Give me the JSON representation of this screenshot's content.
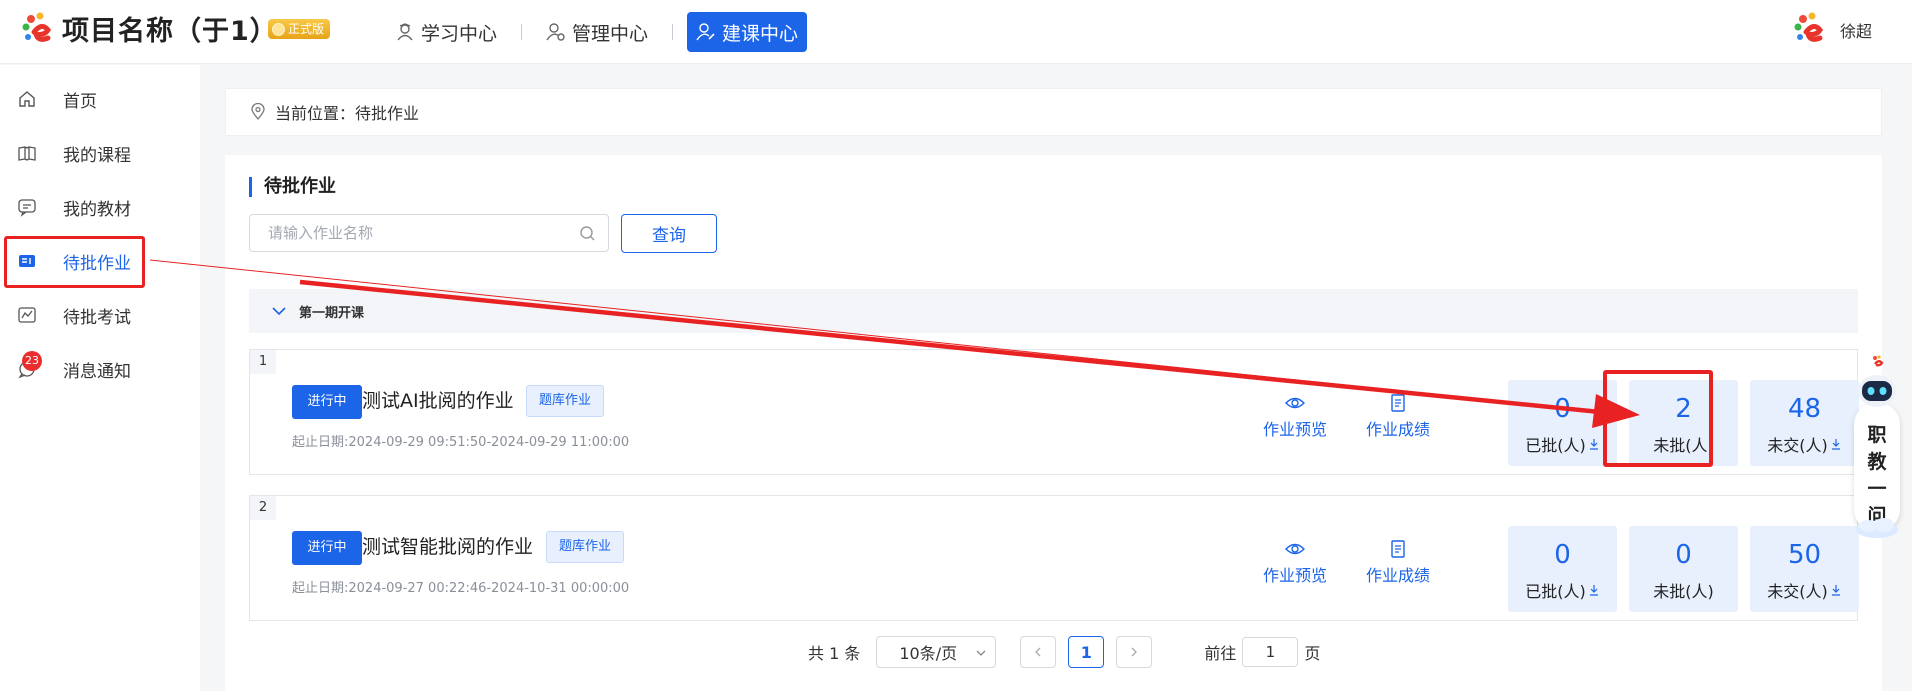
{
  "header": {
    "app_title": "项目名称（于1）",
    "badge": "正式版",
    "nav": [
      {
        "label": "学习中心",
        "icon": "graduate-icon"
      },
      {
        "label": "管理中心",
        "icon": "user-gear-icon"
      },
      {
        "label": "建课中心",
        "icon": "user-edit-icon",
        "active": true
      }
    ],
    "user_name": "徐超"
  },
  "sidebar": {
    "items": [
      {
        "label": "首页",
        "icon": "home-icon"
      },
      {
        "label": "我的课程",
        "icon": "book-icon"
      },
      {
        "label": "我的教材",
        "icon": "chat-doc-icon"
      },
      {
        "label": "待批作业",
        "icon": "homework-icon",
        "active": true
      },
      {
        "label": "待批考试",
        "icon": "exam-icon"
      },
      {
        "label": "消息通知",
        "icon": "message-icon",
        "count": "23"
      }
    ]
  },
  "breadcrumb": {
    "text": "当前位置：待批作业"
  },
  "main": {
    "section_title": "待批作业",
    "search_placeholder": "请输入作业名称",
    "query_label": "查询",
    "group_title": "第一期开课",
    "assignments": [
      {
        "index": "1",
        "status": "进行中",
        "title": "测试AI批阅的作业",
        "type": "题库作业",
        "date": "起止日期:2024-09-29 09:51:50-2024-09-29 11:00:00",
        "actions": [
          "作业预览",
          "作业成绩"
        ],
        "stats": [
          {
            "value": "0",
            "label": "已批(人)"
          },
          {
            "value": "2",
            "label": "未批(人)"
          },
          {
            "value": "48",
            "label": "未交(人)"
          }
        ]
      },
      {
        "index": "2",
        "status": "进行中",
        "title": "测试智能批阅的作业",
        "type": "题库作业",
        "date": "起止日期:2024-09-27 00:22:46-2024-10-31 00:00:00",
        "actions": [
          "作业预览",
          "作业成绩"
        ],
        "stats": [
          {
            "value": "0",
            "label": "已批(人)"
          },
          {
            "value": "0",
            "label": "未批(人)"
          },
          {
            "value": "50",
            "label": "未交(人)"
          }
        ]
      }
    ]
  },
  "pagination": {
    "total": "共 1 条",
    "page_size": "10条/页",
    "current": "1",
    "goto_prefix": "前往",
    "goto_value": "1",
    "goto_suffix": "页"
  },
  "assistant": {
    "chars": [
      "职",
      "教",
      "一",
      "问"
    ]
  },
  "colors": {
    "primary": "#1c64e8",
    "highlight": "#e82222"
  }
}
